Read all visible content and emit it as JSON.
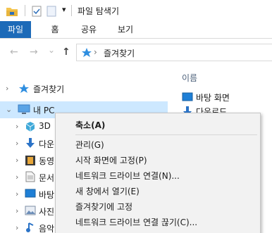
{
  "window": {
    "title": "파일 탐색기",
    "dropdown_glyph": "▾"
  },
  "ribbon": {
    "tabs": [
      {
        "label": "파일"
      },
      {
        "label": "홈"
      },
      {
        "label": "공유"
      },
      {
        "label": "보기"
      }
    ]
  },
  "nav": {
    "back_glyph": "←",
    "forward_glyph": "→",
    "recent_glyph": "⌄",
    "up_glyph": "↑",
    "address_path": "즐겨찾기",
    "address_sep": "›"
  },
  "tree": {
    "favorites": "즐겨찾기",
    "this_pc": "내 PC",
    "items": [
      "3D",
      "다운",
      "동영",
      "문서",
      "바탕",
      "사진",
      "음악"
    ]
  },
  "content": {
    "column_name": "이름",
    "files": [
      "바탕 화면",
      "다운로드"
    ]
  },
  "context_menu": {
    "items": [
      {
        "label": "축소(A)",
        "bold": true
      },
      {
        "label": "관리(G)"
      },
      {
        "label": "시작 화면에 고정(P)"
      },
      {
        "label": "네트워크 드라이브 연결(N)..."
      },
      {
        "label": "새 창에서 열기(E)"
      },
      {
        "label": "즐겨찾기에 고정"
      },
      {
        "label": "네트워크 드라이브 연결 끊기(C)..."
      }
    ]
  },
  "colors": {
    "accent": "#1c6ab8",
    "selection": "#cde8ff",
    "favorite_star": "#2e8ee0",
    "folder_yellow": "#f4c44e"
  }
}
